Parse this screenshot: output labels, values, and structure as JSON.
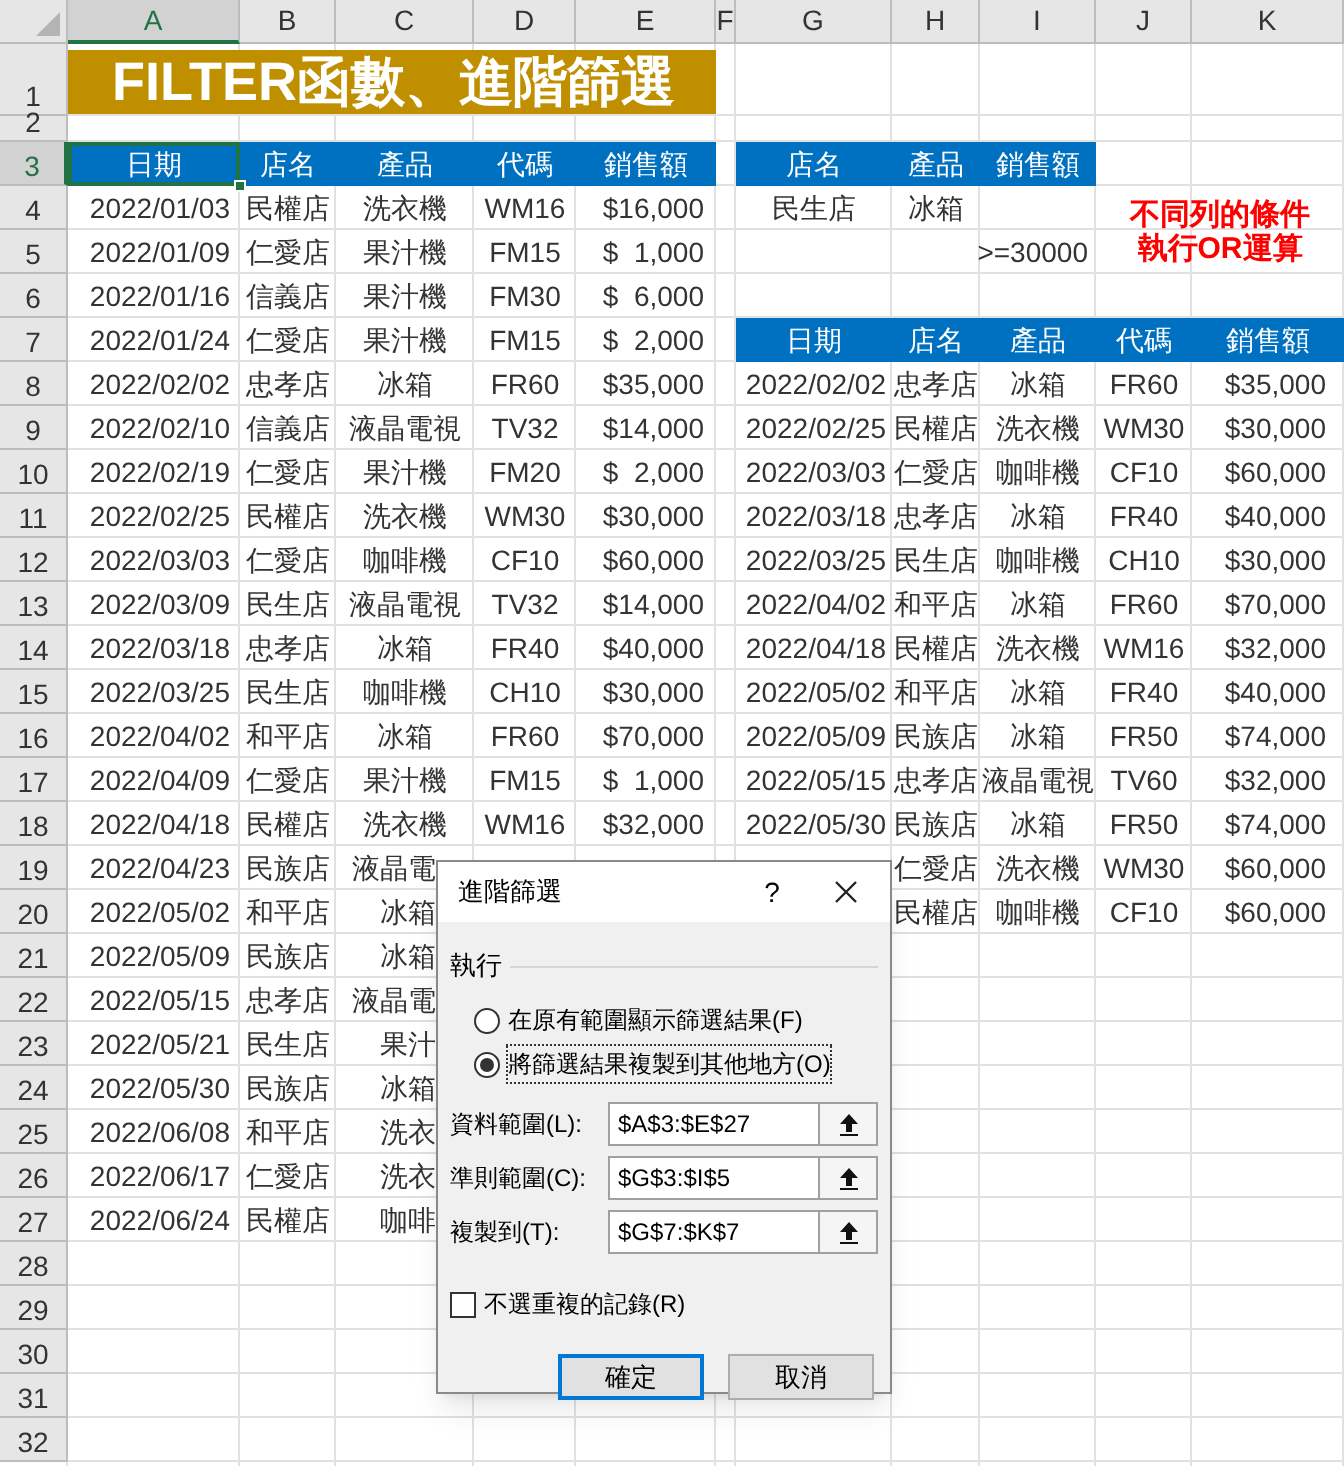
{
  "column_headers": [
    {
      "label": "A",
      "selected": true
    },
    {
      "label": "B",
      "selected": false
    },
    {
      "label": "C",
      "selected": false
    },
    {
      "label": "D",
      "selected": false
    },
    {
      "label": "E",
      "selected": false
    },
    {
      "label": "F",
      "selected": false
    },
    {
      "label": "G",
      "selected": false
    },
    {
      "label": "H",
      "selected": false
    },
    {
      "label": "I",
      "selected": false
    },
    {
      "label": "J",
      "selected": false
    },
    {
      "label": "K",
      "selected": false
    }
  ],
  "row_headers": [
    {
      "label": "1",
      "selected": false
    },
    {
      "label": "2",
      "selected": false
    },
    {
      "label": "3",
      "selected": true
    },
    {
      "label": "4",
      "selected": false
    },
    {
      "label": "5",
      "selected": false
    },
    {
      "label": "6",
      "selected": false
    },
    {
      "label": "7",
      "selected": false
    },
    {
      "label": "8",
      "selected": false
    },
    {
      "label": "9",
      "selected": false
    },
    {
      "label": "10",
      "selected": false
    },
    {
      "label": "11",
      "selected": false
    },
    {
      "label": "12",
      "selected": false
    },
    {
      "label": "13",
      "selected": false
    },
    {
      "label": "14",
      "selected": false
    },
    {
      "label": "15",
      "selected": false
    },
    {
      "label": "16",
      "selected": false
    },
    {
      "label": "17",
      "selected": false
    },
    {
      "label": "18",
      "selected": false
    },
    {
      "label": "19",
      "selected": false
    },
    {
      "label": "20",
      "selected": false
    },
    {
      "label": "21",
      "selected": false
    },
    {
      "label": "22",
      "selected": false
    },
    {
      "label": "23",
      "selected": false
    },
    {
      "label": "24",
      "selected": false
    },
    {
      "label": "25",
      "selected": false
    },
    {
      "label": "26",
      "selected": false
    },
    {
      "label": "27",
      "selected": false
    },
    {
      "label": "28",
      "selected": false
    },
    {
      "label": "29",
      "selected": false
    },
    {
      "label": "30",
      "selected": false
    },
    {
      "label": "31",
      "selected": false
    },
    {
      "label": "32",
      "selected": false
    }
  ],
  "title": "FILTER函數、進階篩選",
  "data_table": {
    "columns": [
      {
        "label": "日期",
        "active": true
      },
      {
        "label": "店名",
        "active": false
      },
      {
        "label": "產品",
        "active": false
      },
      {
        "label": "代碼",
        "active": false
      },
      {
        "label": "銷售額",
        "active": false
      }
    ],
    "rows": [
      [
        "2022/01/03",
        "民權店",
        "洗衣機",
        "WM16",
        "$16,000"
      ],
      [
        "2022/01/09",
        "仁愛店",
        "果汁機",
        "FM15",
        "$  1,000"
      ],
      [
        "2022/01/16",
        "信義店",
        "果汁機",
        "FM30",
        "$  6,000"
      ],
      [
        "2022/01/24",
        "仁愛店",
        "果汁機",
        "FM15",
        "$  2,000"
      ],
      [
        "2022/02/02",
        "忠孝店",
        "冰箱",
        "FR60",
        "$35,000"
      ],
      [
        "2022/02/10",
        "信義店",
        "液晶電視",
        "TV32",
        "$14,000"
      ],
      [
        "2022/02/19",
        "仁愛店",
        "果汁機",
        "FM20",
        "$  2,000"
      ],
      [
        "2022/02/25",
        "民權店",
        "洗衣機",
        "WM30",
        "$30,000"
      ],
      [
        "2022/03/03",
        "仁愛店",
        "咖啡機",
        "CF10",
        "$60,000"
      ],
      [
        "2022/03/09",
        "民生店",
        "液晶電視",
        "TV32",
        "$14,000"
      ],
      [
        "2022/03/18",
        "忠孝店",
        "冰箱",
        "FR40",
        "$40,000"
      ],
      [
        "2022/03/25",
        "民生店",
        "咖啡機",
        "CH10",
        "$30,000"
      ],
      [
        "2022/04/02",
        "和平店",
        "冰箱",
        "FR60",
        "$70,000"
      ],
      [
        "2022/04/09",
        "仁愛店",
        "果汁機",
        "FM15",
        "$  1,000"
      ],
      [
        "2022/04/18",
        "民權店",
        "洗衣機",
        "WM16",
        "$32,000"
      ],
      [
        "2022/04/23",
        "民族店",
        "液晶電"
      ],
      [
        "2022/05/02",
        "和平店",
        "冰箱"
      ],
      [
        "2022/05/09",
        "民族店",
        "冰箱"
      ],
      [
        "2022/05/15",
        "忠孝店",
        "液晶電"
      ],
      [
        "2022/05/21",
        "民生店",
        "果汁"
      ],
      [
        "2022/05/30",
        "民族店",
        "冰箱"
      ],
      [
        "2022/06/08",
        "和平店",
        "洗衣"
      ],
      [
        "2022/06/17",
        "仁愛店",
        "洗衣"
      ],
      [
        "2022/06/24",
        "民權店",
        "咖啡"
      ]
    ]
  },
  "criteria": {
    "columns": [
      "店名",
      "產品",
      "銷售額"
    ],
    "rows": [
      {
        "store": "民生店",
        "product": "冰箱"
      },
      {
        "amount": ">=30000"
      }
    ]
  },
  "note_lines": [
    "不同列的條件",
    "執行OR運算"
  ],
  "result_table": {
    "columns": [
      "日期",
      "店名",
      "產品",
      "代碼",
      "銷售額"
    ],
    "rows": [
      [
        "2022/02/02",
        "忠孝店",
        "冰箱",
        "FR60",
        "$35,000"
      ],
      [
        "2022/02/25",
        "民權店",
        "洗衣機",
        "WM30",
        "$30,000"
      ],
      [
        "2022/03/03",
        "仁愛店",
        "咖啡機",
        "CF10",
        "$60,000"
      ],
      [
        "2022/03/18",
        "忠孝店",
        "冰箱",
        "FR40",
        "$40,000"
      ],
      [
        "2022/03/25",
        "民生店",
        "咖啡機",
        "CH10",
        "$30,000"
      ],
      [
        "2022/04/02",
        "和平店",
        "冰箱",
        "FR60",
        "$70,000"
      ],
      [
        "2022/04/18",
        "民權店",
        "洗衣機",
        "WM16",
        "$32,000"
      ],
      [
        "2022/05/02",
        "和平店",
        "冰箱",
        "FR40",
        "$40,000"
      ],
      [
        "2022/05/09",
        "民族店",
        "冰箱",
        "FR50",
        "$74,000"
      ],
      [
        "2022/05/15",
        "忠孝店",
        "液晶電視",
        "TV60",
        "$32,000"
      ],
      [
        "2022/05/30",
        "民族店",
        "冰箱",
        "FR50",
        "$74,000"
      ],
      [
        "仁愛店",
        "洗衣機",
        "WM30",
        "$60,000"
      ],
      [
        "民權店",
        "咖啡機",
        "CF10",
        "$60,000"
      ]
    ]
  },
  "dialog": {
    "title": "進階篩選",
    "help": "?",
    "group_label": "執行",
    "radios": [
      {
        "label": "在原有範圍顯示篩選結果(F)",
        "selected": false
      },
      {
        "label": "將篩選結果複製到其他地方(O)",
        "selected": true
      }
    ],
    "fields": [
      {
        "label": "資料範圍(L):",
        "value": "$A$3:$E$27"
      },
      {
        "label": "準則範圍(C):",
        "value": "$G$3:$I$5"
      },
      {
        "label": "複製到(T):",
        "value": "$G$7:$K$7"
      }
    ],
    "checkbox": {
      "label": "不選重複的記錄(R)",
      "checked": false
    },
    "buttons": [
      {
        "label": "確定",
        "default": true
      },
      {
        "label": "取消",
        "default": false
      }
    ]
  }
}
